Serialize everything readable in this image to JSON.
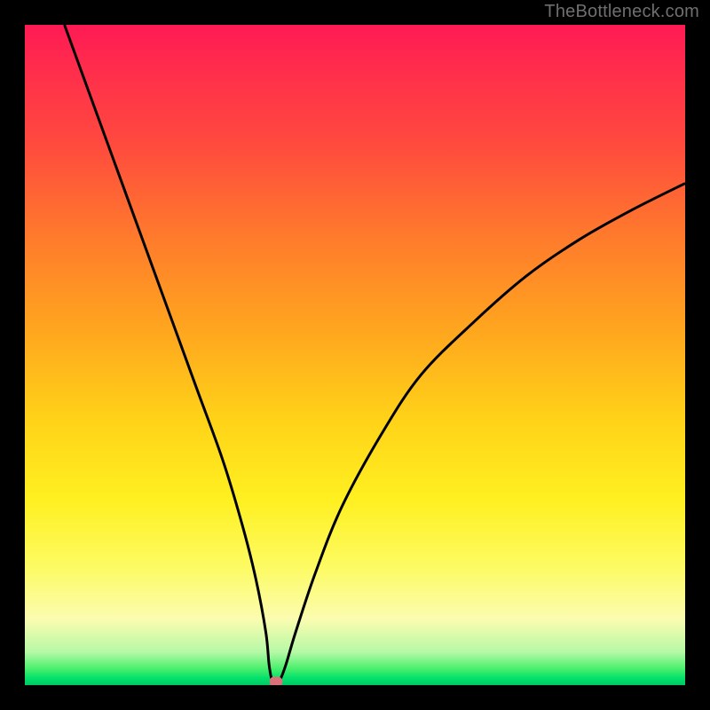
{
  "watermark": "TheBottleneck.com",
  "colors": {
    "page_bg": "#000000",
    "watermark": "#6f6f6f",
    "curve": "#000000",
    "marker": "#d9707a",
    "gradient_top": "#ff1a54",
    "gradient_bottom": "#00c764"
  },
  "chart_data": {
    "type": "line",
    "title": "",
    "xlabel": "",
    "ylabel": "",
    "xlim": [
      0,
      100
    ],
    "ylim": [
      0,
      100
    ],
    "grid": false,
    "legend": false,
    "annotations": [
      "TheBottleneck.com"
    ],
    "series": [
      {
        "name": "bottleneck-curve",
        "x": [
          6,
          10,
          14,
          18,
          22,
          26,
          30,
          33,
          35,
          36.5,
          37,
          37.5,
          38,
          38.5,
          39.5,
          41,
          44,
          48,
          54,
          60,
          68,
          76,
          84,
          92,
          100
        ],
        "y": [
          100,
          89,
          78,
          67,
          56,
          45,
          34,
          24,
          16,
          8,
          3,
          0.5,
          0.5,
          0.5,
          3,
          8,
          17,
          27,
          38,
          47,
          55,
          62,
          67.5,
          72,
          76
        ]
      }
    ],
    "marker": {
      "x": 38,
      "y": 0.5
    }
  }
}
